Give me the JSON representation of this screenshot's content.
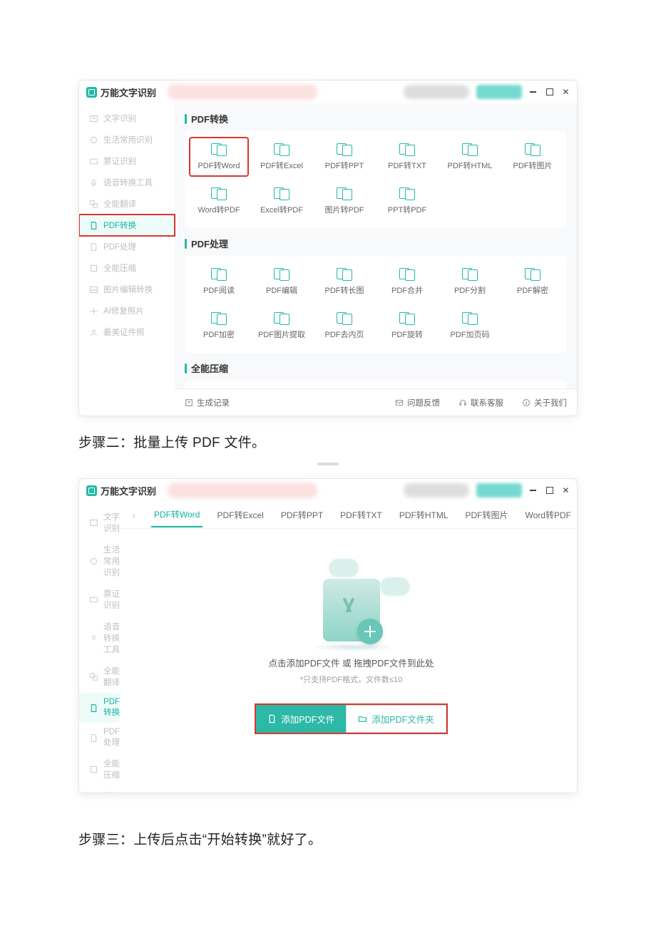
{
  "app": {
    "title": "万能文字识别"
  },
  "win_controls": {
    "min": "minimize",
    "max": "maximize",
    "close": "close"
  },
  "sidebar": {
    "items": [
      {
        "label": "文字识别"
      },
      {
        "label": "生活常用识别"
      },
      {
        "label": "票证识别"
      },
      {
        "label": "语音转换工具"
      },
      {
        "label": "全能翻译"
      },
      {
        "label": "PDF转换"
      },
      {
        "label": "PDF处理"
      },
      {
        "label": "全能压缩"
      },
      {
        "label": "图片编辑转换"
      },
      {
        "label": "AI修复照片"
      },
      {
        "label": "最美证件照"
      }
    ]
  },
  "sections": {
    "convert": {
      "head": "PDF转换",
      "tiles_r1": [
        "PDF转Word",
        "PDF转Excel",
        "PDF转PPT",
        "PDF转TXT",
        "PDF转HTML",
        "PDF转图片"
      ],
      "tiles_r2": [
        "Word转PDF",
        "Excel转PDF",
        "图片转PDF",
        "PPT转PDF"
      ]
    },
    "process": {
      "head": "PDF处理",
      "tiles_r1": [
        "PDF阅读",
        "PDF编辑",
        "PDF转长图",
        "PDF合并",
        "PDF分割",
        "PDF解密"
      ],
      "tiles_r2": [
        "PDF加密",
        "PDF图片提取",
        "PDF去内页",
        "PDF旋转",
        "PDF加页码"
      ]
    },
    "compress": {
      "head": "全能压缩"
    }
  },
  "bottombar": {
    "record": "生成记录",
    "feedback": "问题反馈",
    "support": "联系客服",
    "about": "关于我们"
  },
  "steps": {
    "two": "步骤二：批量上传 PDF 文件。",
    "three": "步骤三：上传后点击“开始转换”就好了。"
  },
  "tabs": [
    "PDF转Word",
    "PDF转Excel",
    "PDF转PPT",
    "PDF转TXT",
    "PDF转HTML",
    "PDF转图片",
    "Word转PDF"
  ],
  "drop": {
    "text": "点击添加PDF文件 或 拖拽PDF文件到此处",
    "note": "*只支持PDF格式，文件数≤10",
    "btn_add_file": "添加PDF文件",
    "btn_add_folder": "添加PDF文件夹"
  }
}
